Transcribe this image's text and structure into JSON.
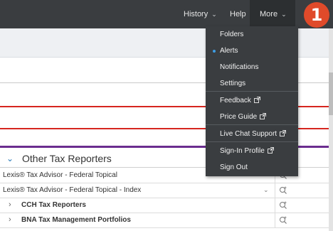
{
  "topnav": {
    "history": "History",
    "help": "Help",
    "more": "More"
  },
  "step_badge": "1",
  "more_menu": {
    "items": [
      {
        "label": "Folders",
        "active": false,
        "external": false
      },
      {
        "label": "Alerts",
        "active": true,
        "external": false
      },
      {
        "label": "Notifications",
        "active": false,
        "external": false
      },
      {
        "label": "Settings",
        "active": false,
        "external": false
      },
      {
        "label": "Feedback",
        "active": false,
        "external": true
      },
      {
        "label": "Price Guide",
        "active": false,
        "external": true
      },
      {
        "label": "Live Chat Support",
        "active": false,
        "external": true
      },
      {
        "label": "Sign-In Profile",
        "active": false,
        "external": true
      },
      {
        "label": "Sign Out",
        "active": false,
        "external": false
      }
    ]
  },
  "section": {
    "title": "Other Tax Reporters"
  },
  "sources": [
    {
      "label": "Lexis® Tax Advisor - Federal Topical",
      "expandable": false,
      "dropdown": false
    },
    {
      "label": "Lexis® Tax Advisor - Federal Topical - Index",
      "expandable": false,
      "dropdown": true
    },
    {
      "label": "CCH Tax Reporters",
      "expandable": true,
      "dropdown": false
    },
    {
      "label": "BNA Tax Management Portfolios",
      "expandable": true,
      "dropdown": false
    }
  ],
  "colors": {
    "topbar": "#3a3d40",
    "badge": "#e04a2a",
    "accent_red": "#d6261f",
    "accent_purple": "#6b2d8f",
    "active_dot": "#3d9de3"
  },
  "icons": {
    "caret": "chevron-down-icon",
    "external": "external-link-icon",
    "search": "search-plus-icon",
    "expand": "chevron-right-icon"
  }
}
